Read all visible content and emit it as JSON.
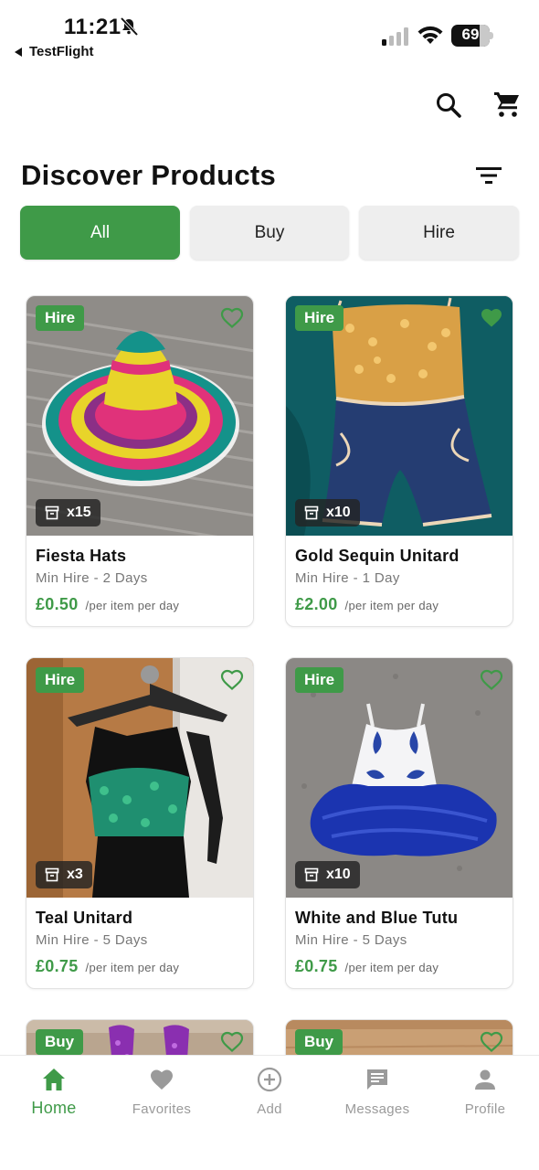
{
  "status_bar": {
    "time": "11:21",
    "back_app": "TestFlight",
    "battery": "69"
  },
  "header": {
    "title": "Discover Products"
  },
  "tabs": [
    {
      "label": "All",
      "active": true
    },
    {
      "label": "Buy",
      "active": false
    },
    {
      "label": "Hire",
      "active": false
    }
  ],
  "products": [
    {
      "badge": "Hire",
      "favorited": false,
      "qty": "x15",
      "name": "Fiesta Hats",
      "min": "Min Hire - 2 Days",
      "price": "£0.50",
      "unit": "/per item per day"
    },
    {
      "badge": "Hire",
      "favorited": true,
      "qty": "x10",
      "name": "Gold Sequin Unitard",
      "min": "Min Hire - 1 Day",
      "price": "£2.00",
      "unit": "/per item per day"
    },
    {
      "badge": "Hire",
      "favorited": false,
      "qty": "x3",
      "name": "Teal Unitard",
      "min": "Min Hire - 5 Days",
      "price": "£0.75",
      "unit": "/per item per day"
    },
    {
      "badge": "Hire",
      "favorited": false,
      "qty": "x10",
      "name": "White and Blue Tutu",
      "min": "Min Hire - 5 Days",
      "price": "£0.75",
      "unit": "/per item per day"
    },
    {
      "badge": "Buy",
      "favorited": false
    },
    {
      "badge": "Buy",
      "favorited": false
    }
  ],
  "bottom_nav": [
    {
      "label": "Home",
      "icon": "home-icon",
      "active": true
    },
    {
      "label": "Favorites",
      "icon": "heart-icon",
      "active": false
    },
    {
      "label": "Add",
      "icon": "add-circle-icon",
      "active": false
    },
    {
      "label": "Messages",
      "icon": "message-icon",
      "active": false
    },
    {
      "label": "Profile",
      "icon": "person-icon",
      "active": false
    }
  ],
  "colors": {
    "accent": "#3f9a48",
    "tab_inactive": "#eeeeee",
    "nav_inactive": "#9a9a9a"
  }
}
